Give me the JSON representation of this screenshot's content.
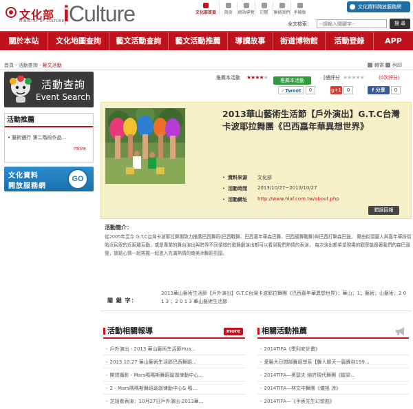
{
  "header": {
    "logo_zh": "文化部",
    "logo_en": "MINISTRY OF CULTURE",
    "brand_i": "i",
    "brand_rest": "Culture",
    "top_links": [
      "文化部首頁",
      "首頁",
      "網站導覽",
      "訂閱",
      "聯絡我們",
      "手機版"
    ],
    "open_data": "文化資料開放服務網",
    "search_label": "全文檢索：",
    "search_placeholder": "--請輸入關鍵字--",
    "search_button": "搜 尋"
  },
  "nav": [
    "關於本站",
    "文化地圖查詢",
    "藝文活動查詢",
    "藝文活動推薦",
    "導讀故事",
    "街道博物館",
    "活動登錄",
    "APP"
  ],
  "breadcrumb": [
    "首頁",
    "活動查詢",
    "藝文活動"
  ],
  "share": {
    "forward": "轉寄",
    "print": "列印"
  },
  "sidebar": {
    "event_search_zh": "活動查詢",
    "event_search_en": "Event Search",
    "rec_title": "活動推薦",
    "rec_item": "藝術銀行 第二階段作品...",
    "more": "more",
    "open_data_line1": "文化資料",
    "open_data_line2": "開放服務網",
    "go": "GO"
  },
  "rating": {
    "label": "推薦本活動",
    "recommend_button": "推薦本活動",
    "score_label": "[總評分",
    "score_value": "(0次評分)",
    "tweet": "Tweet",
    "tweet_count": "0",
    "gplus": "g+1",
    "gplus_count": "0",
    "fb_share": "分享",
    "fb_count": "0"
  },
  "event": {
    "title": "2013華山藝術生活節【戶外演出】G.T.C台灣卡波耶拉舞團《巴西嘉年華異想世界》",
    "source_label": "資料來源",
    "source": "文化部",
    "time_label": "活動時間",
    "time": "2013/10/27~2013/10/27",
    "url_label": "活動網址",
    "url": "http://www.hlaf.com.tw/about.php",
    "report_error": "錯誤回報"
  },
  "intro": {
    "label": "活動簡介：",
    "text": "從2005年至今 G.T.C台灣卡波耶拉舞團致力推廣巴西舞蹈(巴西戰舞、巴西嘉年華森巴舞、巴西緩舞戰舞)與巴西打擊森巴鼓， 爾由街頭藝人與嘉年華踩街貼近民眾的近距離互動，或是專業的舞台演出與跨界不同領域的歌舞劇演出都可以看到我們熱情的表演， 每次演出都希望現場的觀眾能跟著我們的森巴鼓聲，放鬆心情一起搖擺一起進入充滿熱情的南美洲舞蹈氛圍。"
  },
  "keywords": {
    "label": "關 鍵 字：",
    "text": "2013華山藝術生活節【戶外演出】G.T.C台灣卡波耶拉舞團《巴西嘉年華異想世界》；華山；1；藝術；山藝術；2 0 1 3 ；2 0 1 3 華山藝術生活節"
  },
  "related_news": {
    "title": "活動相關報導",
    "more": "more",
    "items": [
      "戶外演出 - 2013 華山藝術生活節Hua...",
      "2013.10.27 華山藝術生活節巴西舞蹈...",
      "開想攝影 - Mars嗎嗎斯舞蹈瑜珈律動中心...",
      "2 - Mars嗎嗎斯舞蹈瑜珈律動中心& 嗎...",
      "芝翊看表演：10月27日戶外演出-2013華..."
    ]
  },
  "related_events": {
    "title": "相關活動推薦",
    "items": [
      "2014TIFA《季利安計畫》",
      "愛藝大日間部舞蹈學系【舞人聊天一篇鋒自199...",
      "2014TIFA—奧瑟夫 納許現代舞團《握梁...",
      "2014TIFA—林文中舞團《儀搖 涼》",
      "2014TIFA—《手表先生幻想曲》"
    ]
  },
  "colors": {
    "accent": "#c0121d",
    "panel": "#f5f0c8",
    "blue": "#1d6fa5"
  }
}
